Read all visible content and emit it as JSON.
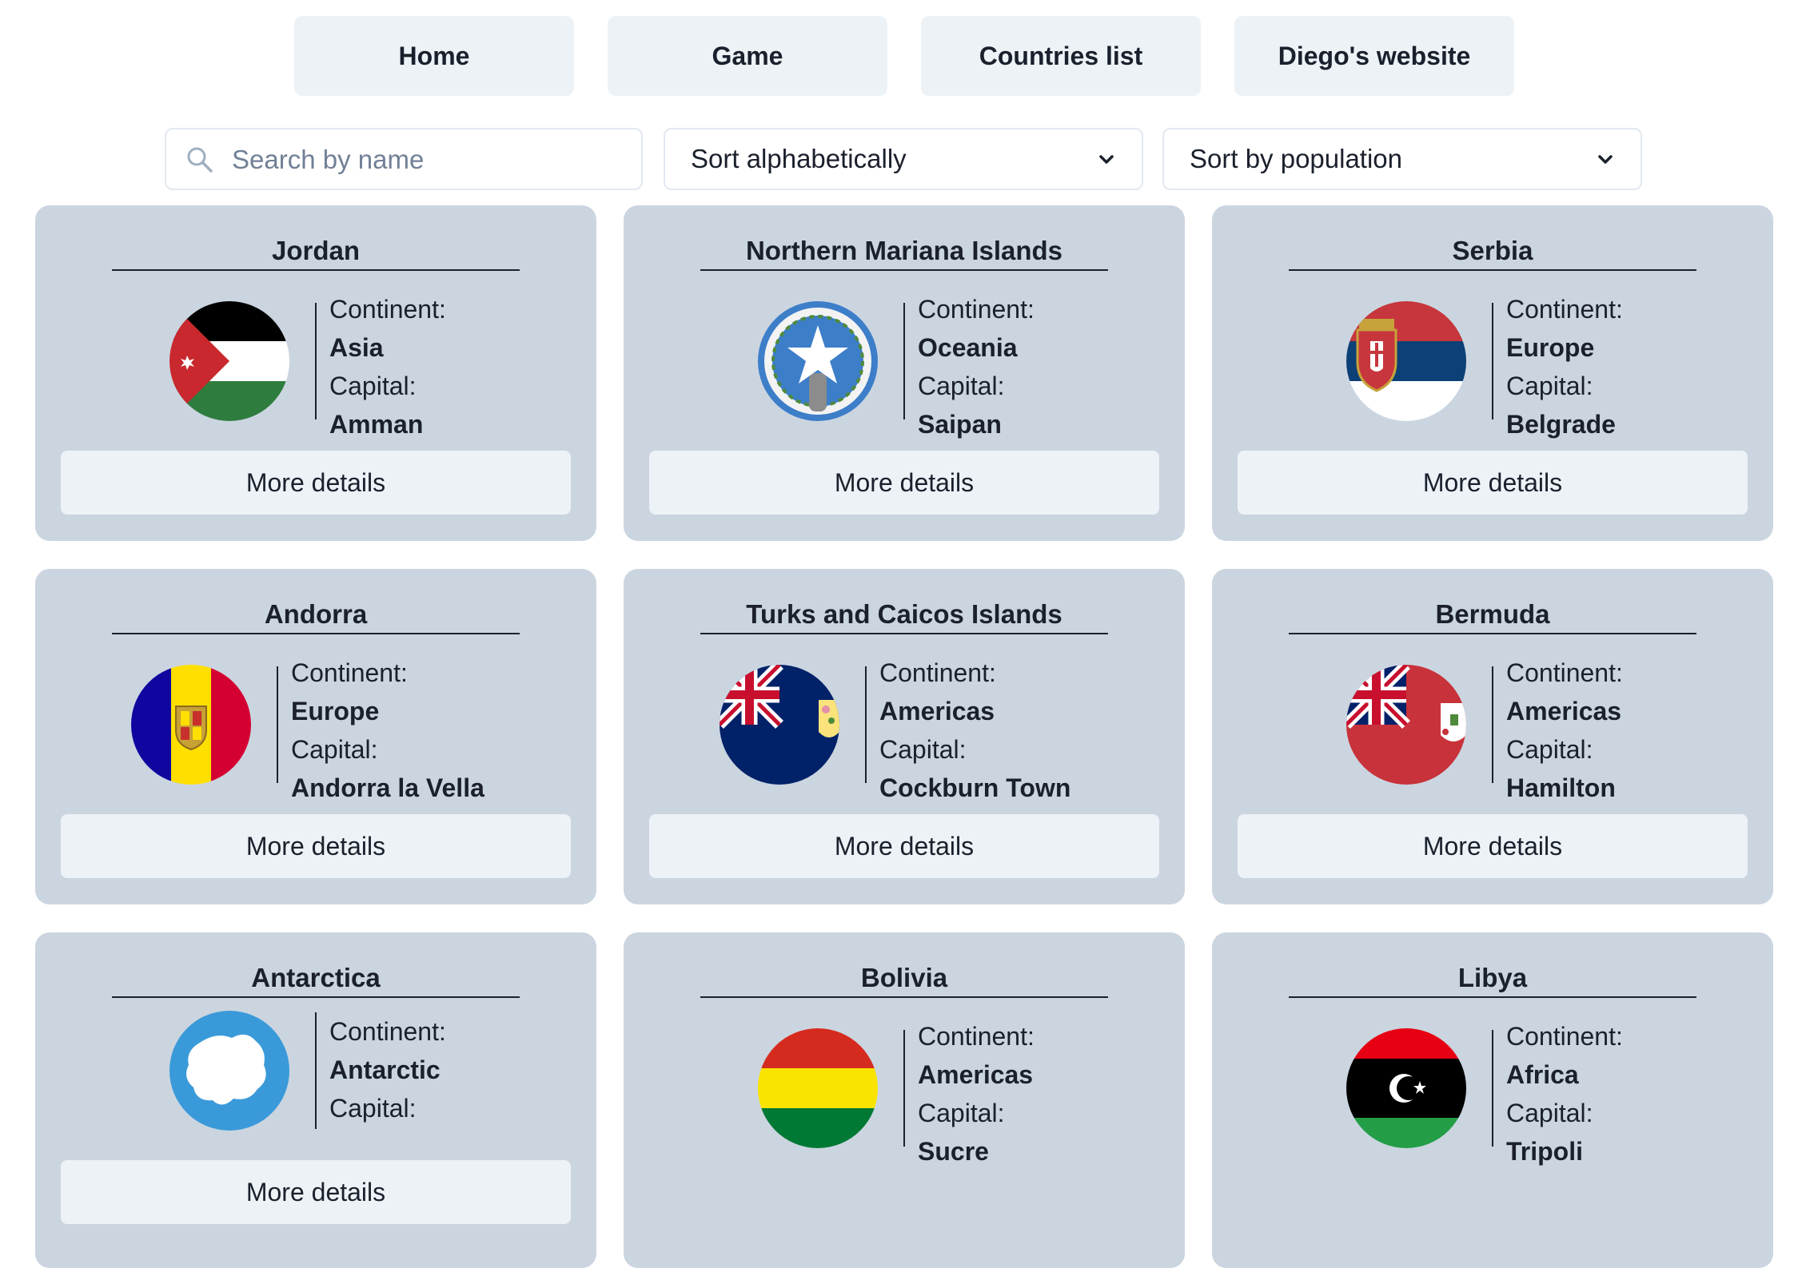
{
  "nav": {
    "home": "Home",
    "game": "Game",
    "countries_list": "Countries list",
    "website": "Diego's website"
  },
  "controls": {
    "search_placeholder": "Search by name",
    "sort_alpha": "Sort alphabetically",
    "sort_population": "Sort by population"
  },
  "labels": {
    "continent": "Continent:",
    "capital": "Capital:",
    "more_details": "More details"
  },
  "countries": [
    {
      "name": "Jordan",
      "continent": "Asia",
      "capital": "Amman",
      "flag": "jordan-flag-icon"
    },
    {
      "name": "Northern Mariana Islands",
      "continent": "Oceania",
      "capital": "Saipan",
      "flag": "northern-mariana-islands-flag-icon"
    },
    {
      "name": "Serbia",
      "continent": "Europe",
      "capital": "Belgrade",
      "flag": "serbia-flag-icon"
    },
    {
      "name": "Andorra",
      "continent": "Europe",
      "capital": "Andorra la Vella",
      "flag": "andorra-flag-icon"
    },
    {
      "name": "Turks and Caicos Islands",
      "continent": "Americas",
      "capital": "Cockburn Town",
      "flag": "turks-and-caicos-flag-icon"
    },
    {
      "name": "Bermuda",
      "continent": "Americas",
      "capital": "Hamilton",
      "flag": "bermuda-flag-icon"
    },
    {
      "name": "Antarctica",
      "continent": "Antarctic",
      "capital": "",
      "flag": "antarctica-flag-icon"
    },
    {
      "name": "Bolivia",
      "continent": "Americas",
      "capital": "Sucre",
      "flag": "bolivia-flag-icon"
    },
    {
      "name": "Libya",
      "continent": "Africa",
      "capital": "Tripoli",
      "flag": "libya-flag-icon"
    }
  ]
}
